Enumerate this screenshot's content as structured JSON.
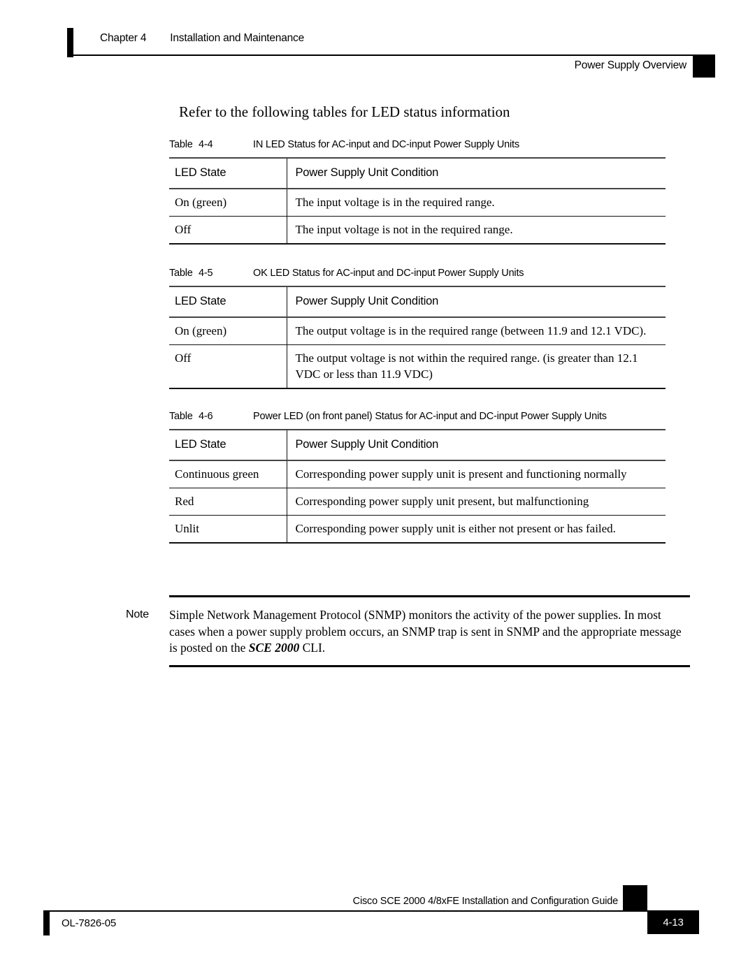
{
  "header": {
    "chapter_label": "Chapter 4",
    "chapter_title": "Installation and Maintenance",
    "running_title": "Power Supply Overview"
  },
  "main": {
    "intro_heading": "Refer to the following tables for LED status information",
    "tables": [
      {
        "caption_label": "Table",
        "caption_number": "4-4",
        "caption_title": "IN LED Status for AC-input and DC-input Power Supply Units",
        "columns": [
          "LED State",
          "Power Supply Unit Condition"
        ],
        "rows": [
          [
            "On (green)",
            "The input voltage is in the required range."
          ],
          [
            "Off",
            "The input voltage is not in the required range."
          ]
        ]
      },
      {
        "caption_label": "Table",
        "caption_number": "4-5",
        "caption_title": "OK LED Status for AC-input and DC-input Power Supply Units",
        "columns": [
          "LED State",
          "Power Supply Unit Condition"
        ],
        "rows": [
          [
            "On (green)",
            "The output voltage is in the required range (between 11.9 and 12.1 VDC)."
          ],
          [
            "Off",
            "The output voltage is not within the required range. (is greater than 12.1 VDC or less than 11.9 VDC)"
          ]
        ]
      },
      {
        "caption_label": "Table",
        "caption_number": "4-6",
        "caption_title": "Power LED (on front panel) Status for AC-input and DC-input Power Supply Units",
        "columns": [
          "LED State",
          "Power Supply Unit Condition"
        ],
        "rows": [
          [
            "Continuous green",
            "Corresponding power supply unit is present and functioning normally"
          ],
          [
            "Red",
            "Corresponding power supply unit present, but malfunctioning"
          ],
          [
            "Unlit",
            "Corresponding power supply unit is either not present or has failed."
          ]
        ]
      }
    ],
    "note": {
      "label": "Note",
      "text_before": "Simple Network Management Protocol (SNMP) monitors the activity of the power supplies. In most cases when a power supply problem occurs, an SNMP trap is sent in SNMP and the appropriate message is posted on the ",
      "emphasis": "SCE 2000",
      "text_after": " CLI."
    }
  },
  "footer": {
    "guide_title": "Cisco SCE 2000 4/8xFE Installation and Configuration Guide",
    "doc_id": "OL-7826-05",
    "page_number": "4-13"
  }
}
